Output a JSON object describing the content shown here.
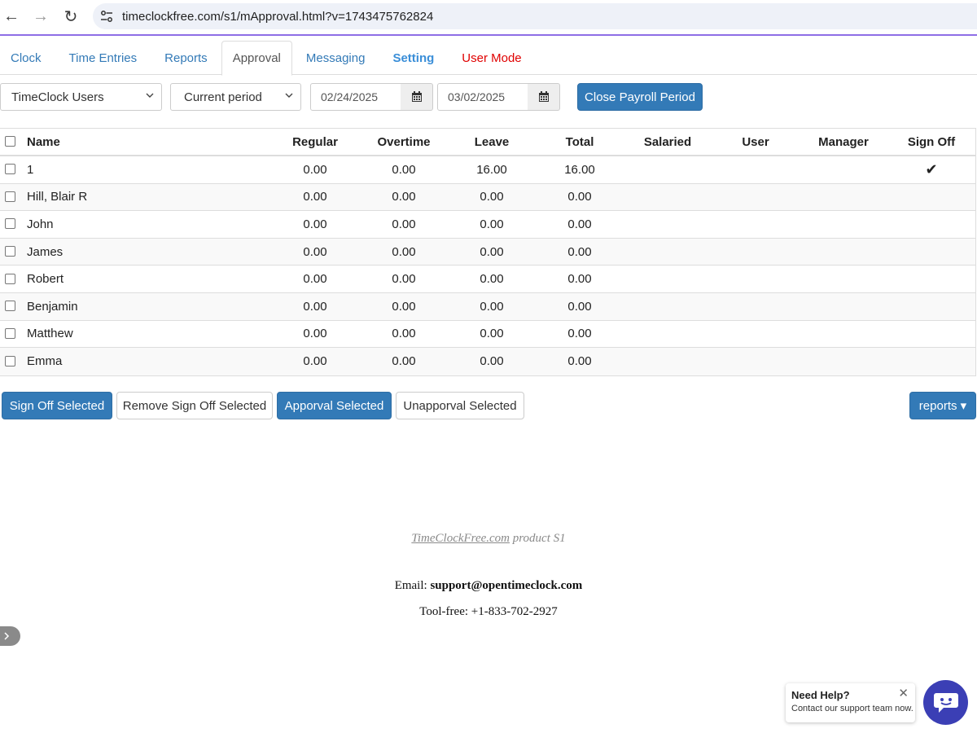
{
  "browser": {
    "url": "timeclockfree.com/s1/mApproval.html?v=1743475762824",
    "back_icon": "←",
    "forward_icon": "→",
    "reload_icon": "↻"
  },
  "tabs": [
    {
      "label": "Clock"
    },
    {
      "label": "Time Entries"
    },
    {
      "label": "Reports"
    },
    {
      "label": "Approval"
    },
    {
      "label": "Messaging"
    },
    {
      "label": "Setting"
    },
    {
      "label": "User Mode"
    }
  ],
  "filters": {
    "user_group": "TimeClock Users",
    "period": "Current period",
    "start_date": "02/24/2025",
    "end_date": "03/02/2025",
    "close_button": "Close Payroll Period"
  },
  "table": {
    "headers": {
      "name": "Name",
      "regular": "Regular",
      "overtime": "Overtime",
      "leave": "Leave",
      "total": "Total",
      "salaried": "Salaried",
      "user": "User",
      "manager": "Manager",
      "signoff": "Sign Off"
    },
    "rows": [
      {
        "name": "1",
        "regular": "0.00",
        "overtime": "0.00",
        "leave": "16.00",
        "total": "16.00",
        "signoff": "✔"
      },
      {
        "name": "Hill, Blair R",
        "regular": "0.00",
        "overtime": "0.00",
        "leave": "0.00",
        "total": "0.00",
        "signoff": ""
      },
      {
        "name": "John",
        "regular": "0.00",
        "overtime": "0.00",
        "leave": "0.00",
        "total": "0.00",
        "signoff": ""
      },
      {
        "name": "James",
        "regular": "0.00",
        "overtime": "0.00",
        "leave": "0.00",
        "total": "0.00",
        "signoff": ""
      },
      {
        "name": "Robert",
        "regular": "0.00",
        "overtime": "0.00",
        "leave": "0.00",
        "total": "0.00",
        "signoff": ""
      },
      {
        "name": "Benjamin",
        "regular": "0.00",
        "overtime": "0.00",
        "leave": "0.00",
        "total": "0.00",
        "signoff": ""
      },
      {
        "name": "Matthew",
        "regular": "0.00",
        "overtime": "0.00",
        "leave": "0.00",
        "total": "0.00",
        "signoff": ""
      },
      {
        "name": "Emma",
        "regular": "0.00",
        "overtime": "0.00",
        "leave": "0.00",
        "total": "0.00",
        "signoff": ""
      }
    ]
  },
  "actions": {
    "sign_off": "Sign Off Selected",
    "remove_sign_off": "Remove Sign Off Selected",
    "approval": "Apporval Selected",
    "unapproval": "Unapporval Selected",
    "reports": "reports ▾"
  },
  "footer": {
    "product_link": "TimeClockFree.com",
    "product_suffix": " product S1",
    "email_label": "Email: ",
    "email": "support@opentimeclock.com",
    "tollfree": "Tool-free: +1-833-702-2927"
  },
  "help": {
    "title": "Need Help?",
    "subtitle": "Contact our support team now.",
    "close": "✕"
  },
  "colors": {
    "primary": "#337ab7",
    "link": "#337ab7",
    "user_mode": "#e00000",
    "chat": "#3b3fb5"
  }
}
